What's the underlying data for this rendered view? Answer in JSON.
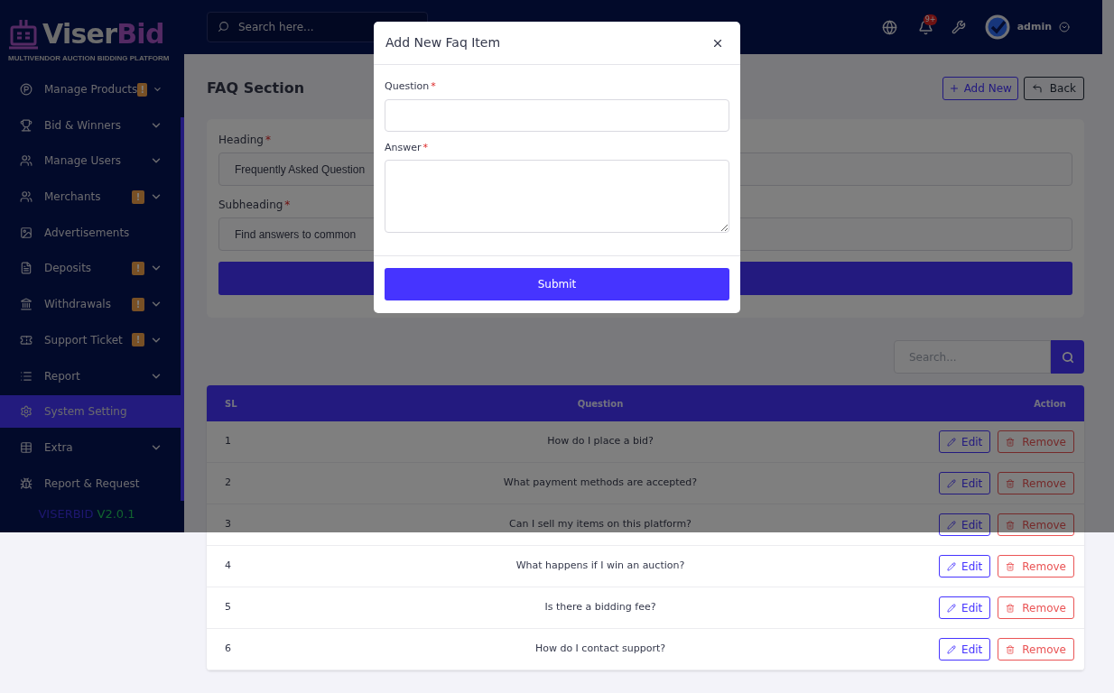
{
  "brand": {
    "name_main": "Viser",
    "name_accent": "Bid",
    "tagline": "MULTIVENDOR AUCTION BIDDING PLATFORM"
  },
  "sidebar": {
    "items": [
      {
        "label": "Manage Products",
        "badge": "!",
        "expandable": true,
        "selected": false
      },
      {
        "label": "Bid & Winners",
        "expandable": true,
        "selected": false
      },
      {
        "label": "Manage Users",
        "expandable": true,
        "selected": false
      },
      {
        "label": "Merchants",
        "badge": "!",
        "expandable": true,
        "selected": false
      },
      {
        "label": "Advertisements",
        "expandable": false,
        "selected": false
      },
      {
        "label": "Deposits",
        "badge": "!",
        "expandable": true,
        "selected": false
      },
      {
        "label": "Withdrawals",
        "badge": "!",
        "expandable": true,
        "selected": false
      },
      {
        "label": "Support Ticket",
        "badge": "!",
        "expandable": true,
        "selected": false
      },
      {
        "label": "Report",
        "expandable": true,
        "selected": false
      },
      {
        "label": "System Setting",
        "expandable": false,
        "selected": true
      },
      {
        "label": "Extra",
        "expandable": true,
        "selected": false
      },
      {
        "label": "Report & Request",
        "expandable": false,
        "selected": false
      }
    ],
    "version": {
      "name": "VISERBID",
      "number": "V2.0.1"
    }
  },
  "header": {
    "search": {
      "placeholder": "Search here..."
    },
    "notification_count": "9+",
    "user": "admin"
  },
  "page": {
    "title": "FAQ Section",
    "buttons": [
      {
        "label": "Add New",
        "kind": "add"
      },
      {
        "label": "Back",
        "kind": "back"
      }
    ]
  },
  "section_form": {
    "fields": [
      {
        "label": "Heading",
        "required_mark": "*",
        "value": "Frequently Asked Question"
      },
      {
        "label": "Subheading",
        "required_mark": "*",
        "value": "Find answers to common"
      }
    ]
  },
  "table": {
    "search": {
      "placeholder": "Search..."
    },
    "columns": [
      "SL",
      "Question",
      "Action"
    ],
    "rows": [
      {
        "sl": "1",
        "question": "How do I place a bid?",
        "edit": "Edit",
        "remove": "Remove"
      },
      {
        "sl": "2",
        "question": "What payment methods are accepted?",
        "edit": "Edit",
        "remove": "Remove"
      },
      {
        "sl": "3",
        "question": "Can I sell my items on this platform?",
        "edit": "Edit",
        "remove": "Remove"
      },
      {
        "sl": "4",
        "question": "What happens if I win an auction?",
        "edit": "Edit",
        "remove": "Remove"
      },
      {
        "sl": "5",
        "question": "Is there a bidding fee?",
        "edit": "Edit",
        "remove": "Remove"
      },
      {
        "sl": "6",
        "question": "How do I contact support?",
        "edit": "Edit",
        "remove": "Remove"
      }
    ]
  },
  "modal": {
    "title": "Add New Faq Item",
    "fields": [
      {
        "label": "Question",
        "required_mark": "*",
        "kind": "input"
      },
      {
        "label": "Answer",
        "required_mark": "*",
        "kind": "textarea"
      }
    ],
    "submit": "Submit"
  }
}
